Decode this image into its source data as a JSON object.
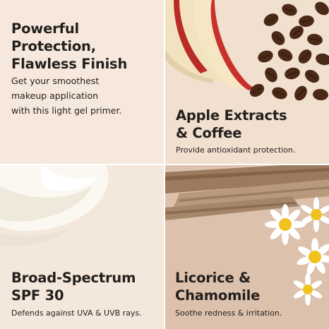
{
  "tiles": [
    {
      "heading_lines": [
        "Powerful",
        "Protection,",
        "Flawless Finish"
      ],
      "body_lines": [
        "Get your smoothest",
        "makeup application",
        "with this light gel primer."
      ],
      "background": "#f6e8dc"
    },
    {
      "heading_lines": [
        "Apple Extracts",
        "& Coffee"
      ],
      "body_lines": [
        "Provide antioxidant protection."
      ],
      "background": "#f1dfcf",
      "image": "apple-slices-and-coffee-beans"
    },
    {
      "heading_lines": [
        "Broad-Spectrum",
        "SPF 30"
      ],
      "body_lines": [
        "Defends against UVA & UVB rays."
      ],
      "background": "#f4e7db",
      "image": "white-gel-swirl"
    },
    {
      "heading_lines": [
        "Licorice &",
        "Chamomile"
      ],
      "body_lines": [
        "Soothe redness & irritation."
      ],
      "background": "#dcc1ad",
      "image": "licorice-root-and-chamomile-flowers"
    }
  ],
  "colors": {
    "text": "#231f1c",
    "apple_skin": "#c8322c",
    "coffee_bean": "#4a2a17",
    "chamomile_center": "#f0c21d"
  }
}
